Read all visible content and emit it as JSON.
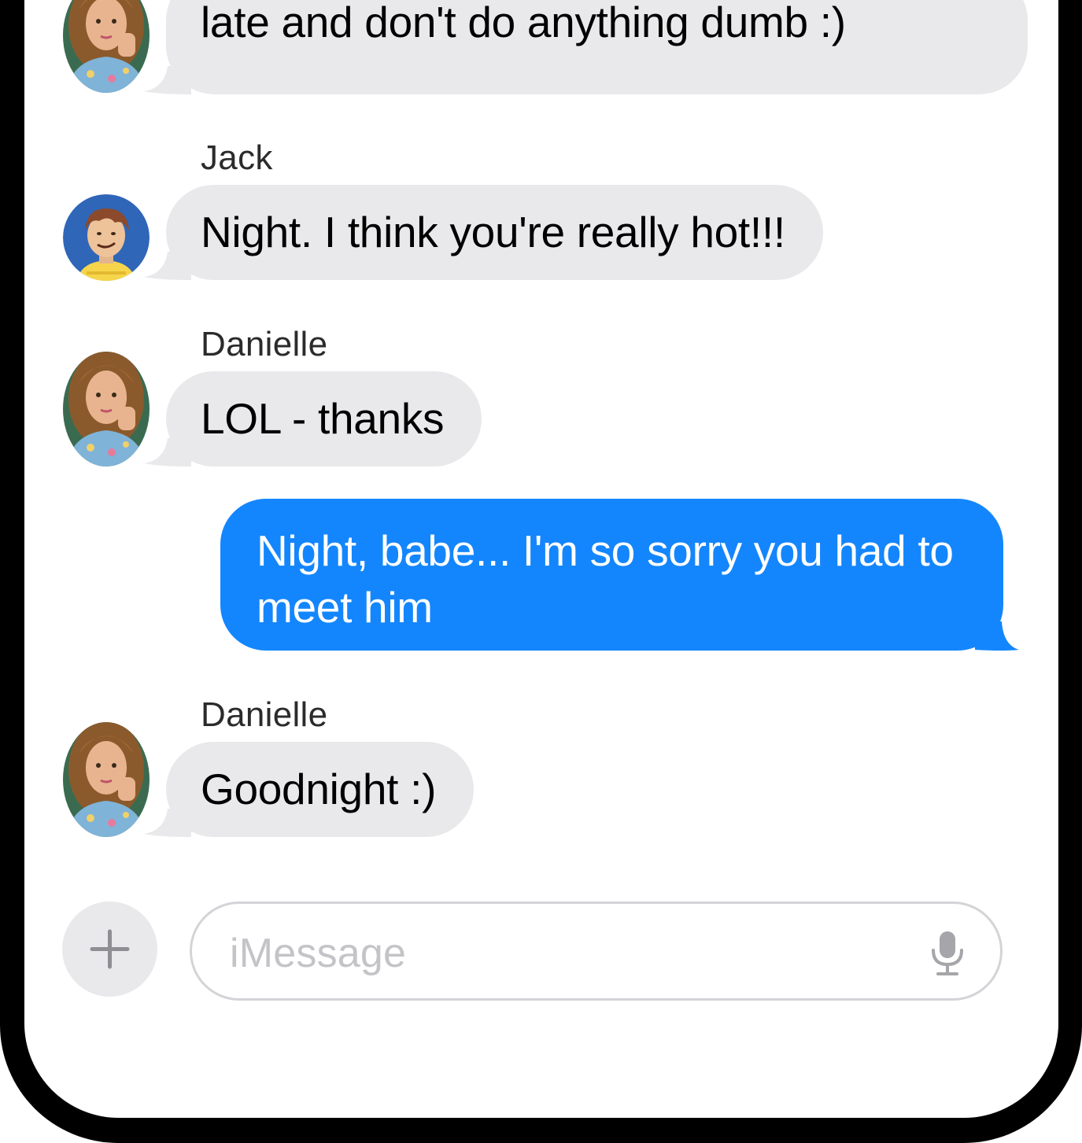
{
  "messages": [
    {
      "id": "m1",
      "sender": "",
      "direction": "incoming",
      "text": "It's bed time for me, boys.  Don't stay out late and don't do anything dumb :)"
    },
    {
      "id": "m2",
      "sender": "Jack",
      "direction": "incoming",
      "text": "Night.  I think you're really hot!!!"
    },
    {
      "id": "m3",
      "sender": "Danielle",
      "direction": "incoming",
      "text": "LOL - thanks"
    },
    {
      "id": "m4",
      "sender": "",
      "direction": "outgoing",
      "text": "Night, babe... I'm so sorry you had to meet him"
    },
    {
      "id": "m5",
      "sender": "Danielle",
      "direction": "incoming",
      "text": "Goodnight :)"
    }
  ],
  "composer": {
    "placeholder": "iMessage",
    "plus_icon": "plus-icon",
    "mic_icon": "microphone-icon"
  },
  "colors": {
    "incoming_bubble": "#e9e9eb",
    "outgoing_bubble": "#1486fd",
    "frame": "#000000"
  }
}
